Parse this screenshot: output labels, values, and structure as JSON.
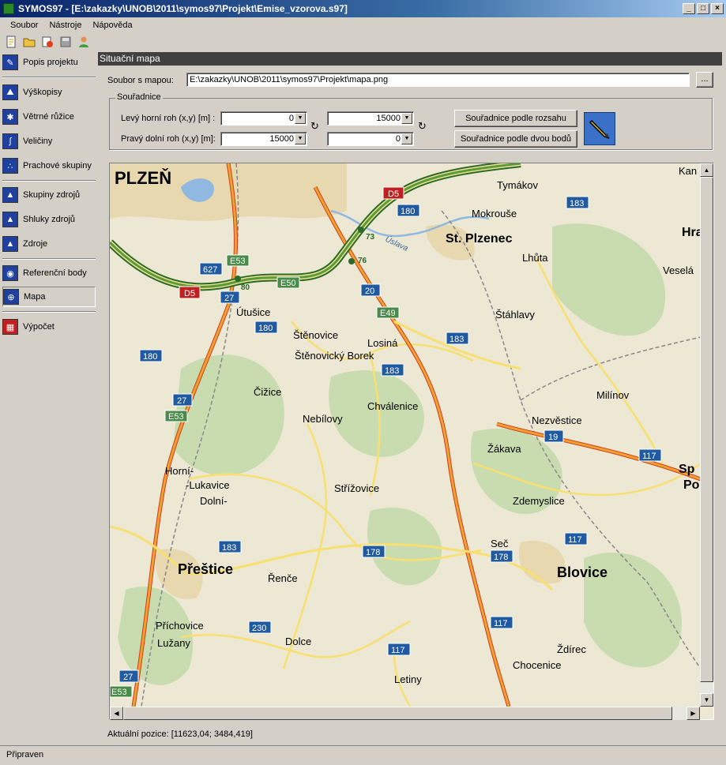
{
  "window": {
    "title": "SYMOS97 - [E:\\zakazky\\UNOB\\2011\\symos97\\Projekt\\Emise_vzorova.s97]",
    "min_label": "_",
    "max_label": "□",
    "close_label": "×"
  },
  "menu": {
    "items": [
      "Soubor",
      "Nástroje",
      "Nápověda"
    ]
  },
  "toolbar": {
    "icons": [
      "new-file-icon",
      "open-folder-icon",
      "refresh-icon",
      "save-icon",
      "user-icon"
    ]
  },
  "sidebar": {
    "items": [
      {
        "label": "Popis projektu",
        "icon": "description-icon",
        "color": "#2040a0"
      },
      {
        "label": "Výškopisy",
        "icon": "terrain-icon",
        "color": "#2040a0"
      },
      {
        "label": "Větrné růžice",
        "icon": "wind-rose-icon",
        "color": "#2040a0"
      },
      {
        "label": "Veličiny",
        "icon": "quantity-icon",
        "color": "#2040a0"
      },
      {
        "label": "Prachové skupiny",
        "icon": "dust-icon",
        "color": "#2040a0"
      },
      {
        "label": "Skupiny zdrojů",
        "icon": "source-groups-icon",
        "color": "#2040a0"
      },
      {
        "label": "Shluky zdrojů",
        "icon": "source-clusters-icon",
        "color": "#2040a0"
      },
      {
        "label": "Zdroje",
        "icon": "sources-icon",
        "color": "#2040a0"
      },
      {
        "label": "Referenční body",
        "icon": "reference-points-icon",
        "color": "#2040a0"
      },
      {
        "label": "Mapa",
        "icon": "map-icon",
        "color": "#2040a0"
      },
      {
        "label": "Výpočet",
        "icon": "calculation-icon",
        "color": "#c02020"
      }
    ],
    "active_index": 9
  },
  "content": {
    "title": "Situační mapa",
    "map_file_label": "Soubor s mapou:",
    "map_file_value": "E:\\zakazky\\UNOB\\2011\\symos97\\Projekt\\mapa.png",
    "browse_label": "...",
    "coords_group_title": "Souřadnice",
    "top_left_label": "Levý horní roh (x,y) [m] :",
    "bottom_right_label": "Pravý dolní roh (x,y) [m]:",
    "top_left_x": "0",
    "top_left_y": "15000",
    "bottom_right_x": "15000",
    "bottom_right_y": "0",
    "btn_by_extent": "Souřadnice podle rozsahu",
    "btn_by_two_points": "Souřadnice podle dvou bodů",
    "position_readout": "Aktuální pozice: [11623,04; 3484,419]"
  },
  "map": {
    "towns": [
      "PLZEŇ",
      "Tymákov",
      "Mokrouše",
      "St. Plzenec",
      "Lhůta",
      "Hra",
      "Veselá",
      "Kan",
      "Štáhlavy",
      "Útušice",
      "Štěnovice",
      "Losiná",
      "Štěnovický Borek",
      "Čižice",
      "Chválenice",
      "Nebílovy",
      "Milínov",
      "Nezvěstice",
      "Žákava",
      "Sp",
      "Po",
      "Horní-",
      "-Lukavice",
      "Dolní-",
      "Střížovice",
      "Zdemyslice",
      "Seč",
      "Přeštice",
      "Řenče",
      "Blovice",
      "Příchovice",
      "Lužany",
      "Dolce",
      "Ždírec",
      "Chocenice",
      "Letiny"
    ],
    "route_labels": [
      "D5",
      "D5",
      "E53",
      "E50",
      "E49",
      "E53",
      "E53",
      "180",
      "183",
      "627",
      "27",
      "180",
      "20",
      "183",
      "180",
      "183",
      "27",
      "19",
      "117",
      "183",
      "178",
      "178",
      "117",
      "230",
      "117",
      "117",
      "27",
      "73",
      "76",
      "80",
      "Úslava"
    ],
    "colors": {
      "background": "#ece8d4",
      "highway": "#5a9a3a",
      "main_road": "#f0a030",
      "road": "#f8e070",
      "forest": "#c8dcb0",
      "water": "#90b8e0",
      "shield": "#205aa0",
      "e_shield": "#4a8a4a",
      "d_shield": "#c02020"
    }
  },
  "status": {
    "text": "Připraven"
  }
}
